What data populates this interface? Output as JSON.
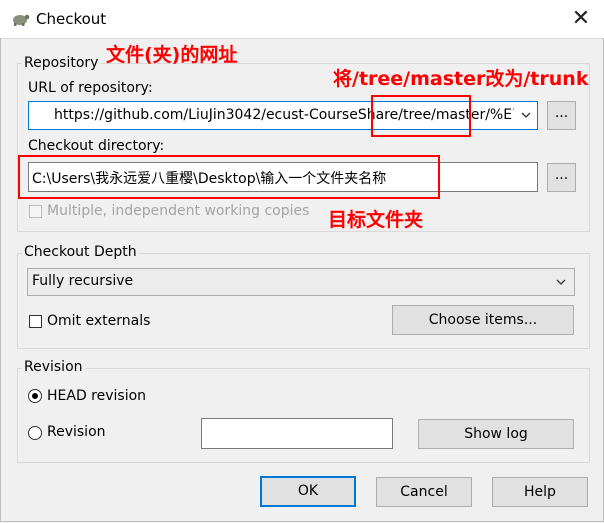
{
  "window": {
    "title": "Checkout"
  },
  "repository": {
    "group_label": "Repository",
    "url_label": "URL of repository:",
    "url_value": "https://github.com/LiuJin3042/ecust-CourseShare/tree/master/%E7%",
    "browse_label": "...",
    "dir_label": "Checkout directory:",
    "dir_value": "C:\\Users\\我永远爱八重樱\\Desktop\\输入一个文件夹名称",
    "dir_browse_label": "...",
    "multiple_copies_label": "Multiple, independent working copies"
  },
  "depth": {
    "group_label": "Checkout Depth",
    "selected": "Fully recursive",
    "omit_externals_label": "Omit externals",
    "choose_items_label": "Choose items..."
  },
  "revision": {
    "group_label": "Revision",
    "head_label": "HEAD revision",
    "revision_label": "Revision",
    "revision_value": "",
    "show_log_label": "Show log"
  },
  "buttons": {
    "ok": "OK",
    "cancel": "Cancel",
    "help": "Help"
  },
  "annotations": {
    "url_note": "文件(夹)的网址",
    "replace_note": "将/tree/master改为/trunk",
    "dir_note": "目标文件夹",
    "color": "#ff0000"
  }
}
